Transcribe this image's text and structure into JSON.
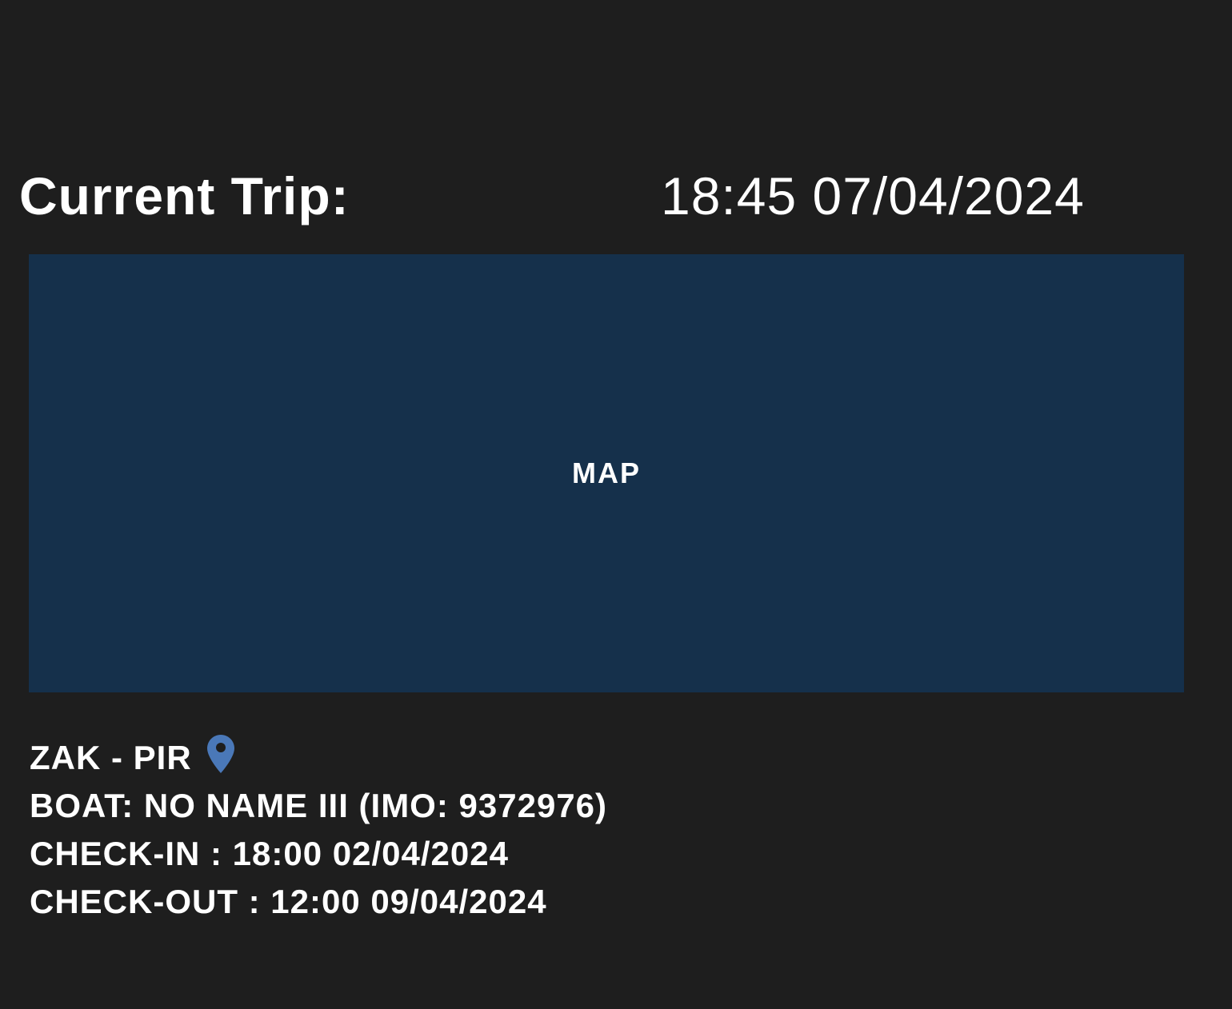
{
  "header": {
    "title": "Current Trip:",
    "datetime": "18:45 07/04/2024"
  },
  "map": {
    "label": "MAP",
    "background_color": "#15304b"
  },
  "trip": {
    "route": "ZAK - PIR",
    "route_icon": "location-pin-icon",
    "pin_color": "#4a78b8",
    "boat": "BOAT: NO NAME III (IMO: 9372976)",
    "check_in": "CHECK-IN : 18:00 02/04/2024",
    "check_out": "CHECK-OUT : 12:00 09/04/2024"
  }
}
